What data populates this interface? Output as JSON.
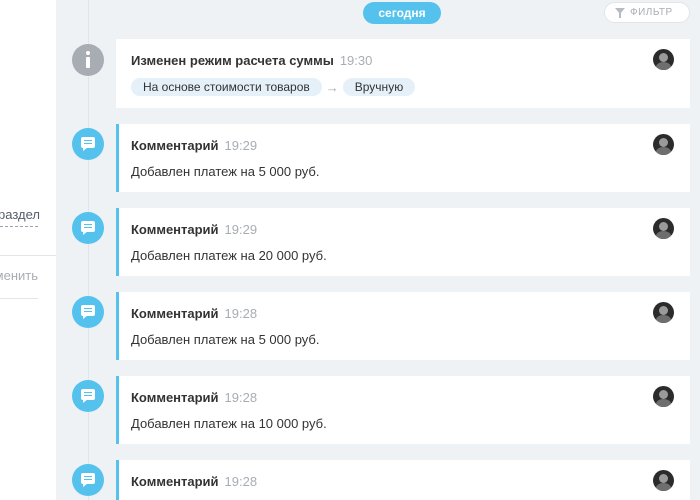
{
  "left_panel": {
    "section_link_fragment": "раздел",
    "cancel_fragment": "менить"
  },
  "header": {
    "today_label": "сегодня",
    "filter_label": "ФИЛЬТР"
  },
  "events": [
    {
      "type": "info",
      "title": "Изменен режим расчета суммы",
      "time": "19:30",
      "from": "На основе стоимости товаров",
      "arrow": "→",
      "to": "Вручную"
    },
    {
      "type": "comment",
      "title": "Комментарий",
      "time": "19:29",
      "text": "Добавлен платеж на 5 000 руб."
    },
    {
      "type": "comment",
      "title": "Комментарий",
      "time": "19:29",
      "text": "Добавлен платеж на 20 000 руб."
    },
    {
      "type": "comment",
      "title": "Комментарий",
      "time": "19:28",
      "text": "Добавлен платеж на 5 000 руб."
    },
    {
      "type": "comment",
      "title": "Комментарий",
      "time": "19:28",
      "text": "Добавлен платеж на 10 000 руб."
    },
    {
      "type": "comment",
      "title": "Комментарий",
      "time": "19:28",
      "text": ""
    }
  ],
  "colors": {
    "accent": "#55c2ee",
    "info_icon": "#a8adb4",
    "background": "#eef2f4",
    "tag_background": "#e5f0f9"
  },
  "icons": {
    "info": "info-icon",
    "comment": "comment-icon",
    "filter": "funnel-icon",
    "avatar": "user-avatar"
  }
}
